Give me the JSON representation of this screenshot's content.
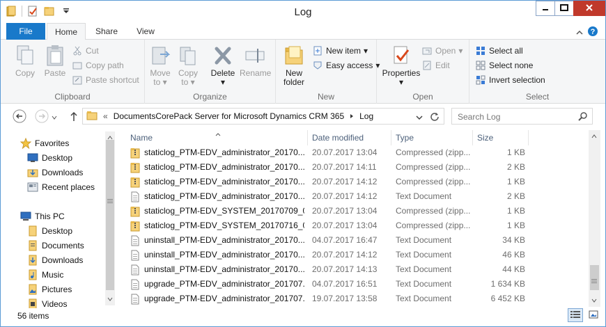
{
  "window": {
    "title": "Log",
    "controls": {
      "minimize": "minimize-icon",
      "maximize": "maximize-icon",
      "close": "close-icon"
    }
  },
  "ribbon_tabs": [
    "File",
    "Home",
    "Share",
    "View"
  ],
  "ribbon": {
    "clipboard": {
      "label": "Clipboard",
      "copy": "Copy",
      "paste": "Paste",
      "cut": "Cut",
      "copy_path": "Copy path",
      "paste_shortcut": "Paste shortcut"
    },
    "organize": {
      "label": "Organize",
      "move_to": "Move",
      "move_to_2": "to",
      "copy_to": "Copy",
      "copy_to_2": "to",
      "delete": "Delete",
      "rename": "Rename"
    },
    "new": {
      "label": "New",
      "new_folder": "New",
      "new_folder_2": "folder",
      "new_item": "New item",
      "easy_access": "Easy access"
    },
    "open": {
      "label": "Open",
      "properties": "Properties",
      "open": "Open",
      "edit": "Edit"
    },
    "select": {
      "label": "Select",
      "select_all": "Select all",
      "select_none": "Select none",
      "invert_selection": "Invert selection"
    }
  },
  "address": {
    "prefix": "«",
    "path": [
      "DocumentsCorePack Server for Microsoft Dynamics CRM 365",
      "Log"
    ],
    "search_placeholder": "Search Log"
  },
  "navpane": {
    "favorites": {
      "label": "Favorites",
      "items": [
        "Desktop",
        "Downloads",
        "Recent places"
      ]
    },
    "thispc": {
      "label": "This PC",
      "items": [
        "Desktop",
        "Documents",
        "Downloads",
        "Music",
        "Pictures",
        "Videos"
      ]
    }
  },
  "columns": {
    "name": "Name",
    "date": "Date modified",
    "type": "Type",
    "size": "Size"
  },
  "files": [
    {
      "name": "staticlog_PTM-EDV_administrator_20170...",
      "date": "20.07.2017 13:04",
      "type": "Compressed (zipp...",
      "size": "1 KB",
      "icon": "zip-folder"
    },
    {
      "name": "staticlog_PTM-EDV_administrator_20170...",
      "date": "20.07.2017 14:11",
      "type": "Compressed (zipp...",
      "size": "2 KB",
      "icon": "zip-folder"
    },
    {
      "name": "staticlog_PTM-EDV_administrator_20170...",
      "date": "20.07.2017 14:12",
      "type": "Compressed (zipp...",
      "size": "1 KB",
      "icon": "zip-folder"
    },
    {
      "name": "staticlog_PTM-EDV_administrator_20170...",
      "date": "20.07.2017 14:12",
      "type": "Text Document",
      "size": "2 KB",
      "icon": "text"
    },
    {
      "name": "staticlog_PTM-EDV_SYSTEM_20170709_0...",
      "date": "20.07.2017 13:04",
      "type": "Compressed (zipp...",
      "size": "1 KB",
      "icon": "zip-folder"
    },
    {
      "name": "staticlog_PTM-EDV_SYSTEM_20170716_0...",
      "date": "20.07.2017 13:04",
      "type": "Compressed (zipp...",
      "size": "1 KB",
      "icon": "zip-folder"
    },
    {
      "name": "uninstall_PTM-EDV_administrator_20170...",
      "date": "04.07.2017 16:47",
      "type": "Text Document",
      "size": "34 KB",
      "icon": "text"
    },
    {
      "name": "uninstall_PTM-EDV_administrator_20170...",
      "date": "20.07.2017 14:12",
      "type": "Text Document",
      "size": "46 KB",
      "icon": "text"
    },
    {
      "name": "uninstall_PTM-EDV_administrator_20170...",
      "date": "20.07.2017 14:13",
      "type": "Text Document",
      "size": "44 KB",
      "icon": "text"
    },
    {
      "name": "upgrade_PTM-EDV_administrator_201707...",
      "date": "04.07.2017 16:51",
      "type": "Text Document",
      "size": "1 634 KB",
      "icon": "text"
    },
    {
      "name": "upgrade_PTM-EDV_administrator_201707...",
      "date": "19.07.2017 13:58",
      "type": "Text Document",
      "size": "6 452 KB",
      "icon": "text"
    }
  ],
  "status": {
    "count": "56 items"
  }
}
